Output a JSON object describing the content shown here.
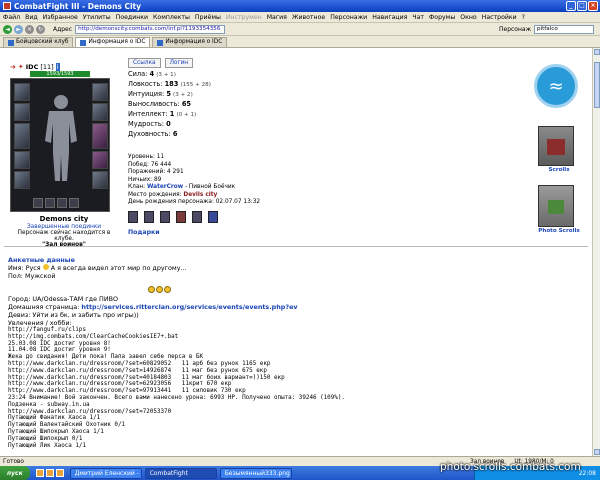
{
  "window": {
    "title": "CombatFight III - Demons City"
  },
  "menu": [
    "Файл",
    "Вид",
    "Избранное",
    "Утилиты",
    "Поединки",
    "Комплекты",
    "Приёмы",
    "Магия",
    "Животное",
    "Персонажи",
    "Навигация",
    "Чат",
    "Форумы",
    "Окно",
    "Настройки",
    "?"
  ],
  "menu_disabled_label": "Инструмен",
  "address": {
    "label": "Адрес",
    "url": "http://demonscity.combats.com/inf.pl?1193354356",
    "person_label": "Персонаж",
    "person_value": "pitfalco"
  },
  "tabs": [
    {
      "label": "Бойцовский клуб",
      "active": false
    },
    {
      "label": "Информация о IDC",
      "active": true
    },
    {
      "label": "Информация о IDC",
      "active": false
    }
  ],
  "character": {
    "name": "IDC",
    "level": "[11]",
    "hp": "1593/1593",
    "location_title": "Demons city",
    "location_sub": "Завершенные поединки",
    "location_note": "Персонаж сейчас находится в клубе.",
    "room": "\"Зал воинов\""
  },
  "stats_buttons": [
    "Ссылка",
    "Логин"
  ],
  "stats": [
    {
      "label": "Сила:",
      "value": "4",
      "extra": "(3 + 1)"
    },
    {
      "label": "Ловкость:",
      "value": "183",
      "extra": "(155 + 28)"
    },
    {
      "label": "Интуиция:",
      "value": "5",
      "extra": "(3 + 2)"
    },
    {
      "label": "Выносливость:",
      "value": "65",
      "extra": ""
    },
    {
      "label": "Интеллект:",
      "value": "1",
      "extra": "(0 + 1)"
    },
    {
      "label": "Мудрость:",
      "value": "0",
      "extra": ""
    },
    {
      "label": "Духовность:",
      "value": "6",
      "extra": ""
    }
  ],
  "info": [
    "Уровень: 11",
    "Побед: 76 444",
    "Поражений: 4 291",
    "Ничьих: 89"
  ],
  "clan_label": "Клан:",
  "clan_name": "WaterCrow",
  "clan_rest": "- Пивной Боёчик",
  "city_label": "Место рождения:",
  "city_value": "Devils city",
  "birthday": "День рождения персонажа: 02.07.07 13:32",
  "gifts": "Подарки",
  "right_icons": {
    "scrolls_label": "Scrolls",
    "photo_label": "Photo Scrolls"
  },
  "anketa": {
    "heading": "Анкетные данные",
    "name_line": "Имя: Руся",
    "name_line_rest": " А я всегда видел этот мир по другому...",
    "sex_line": "Пол: Мужской",
    "city_line": "Город: UA/Odessa-ТАМ где ПИВО",
    "homepage_label": "Домашняя страница: ",
    "homepage_url": "http://services.ritterclan.org/services/events/events.php?ev",
    "motto": "Девиз: Уйти из бк, и забить про игры))",
    "hobby_label": "Увлечения / хобби:",
    "lines": [
      "http://fanguf.ru/clips",
      "http://img.combats.com/ClearCacheCookiesIE7+.bat",
      "25.03.08 IDC достиг уровня 8!",
      "11.04.08 IDC достиг уровня 9!",
      "Жека до свидания! Дети пока! Папа завел себе перса в БК",
      "http://www.darkclan.ru/dressroom/?set=60829052   11 арб без рунок 1165 екр",
      "http://www.darkclan.ru/dressroom/?set=14926874   11 маг без рунок 675 екр",
      "http://www.darkclan.ru/dressroom/?set=40184803   11 маг боих вариант=))150 екр",
      "http://www.darkclan.ru/dressroom/?set=62923056   11крит 670 екр",
      "http://www.darkclan.ru/dressroom/?set=97913441   11 силовик 730 екр",
      "23:24 Внимание! Вой закончен. Всего вами нанесено урона: 6993 HP. Получено опыта: 39246 (109%).",
      "Подзенка - subway.in.ua",
      "http://www.darkclan.ru/dressroom/?set=72053370",
      "Путающий Фанатик Хаоса 1/1",
      "Путающий Валентайский Охотник 0/1",
      "Путающий Шипокрыл Хаоса 1/1",
      "Путающий Шипокрыл 0/1",
      "Путающий Лик Хаоса 1/1"
    ]
  },
  "statusbar": {
    "left": "Готово",
    "zone": "Зал воинов",
    "zoom": "Ut: 1980/М: 0"
  },
  "taskbar": {
    "start": "пуск",
    "tasks": [
      "Дмитрий Еленский - ...",
      "CombatFight",
      "Безымянный333.png ..."
    ],
    "clock": "22:08"
  },
  "watermark": "photo.scrolls.combats.com"
}
